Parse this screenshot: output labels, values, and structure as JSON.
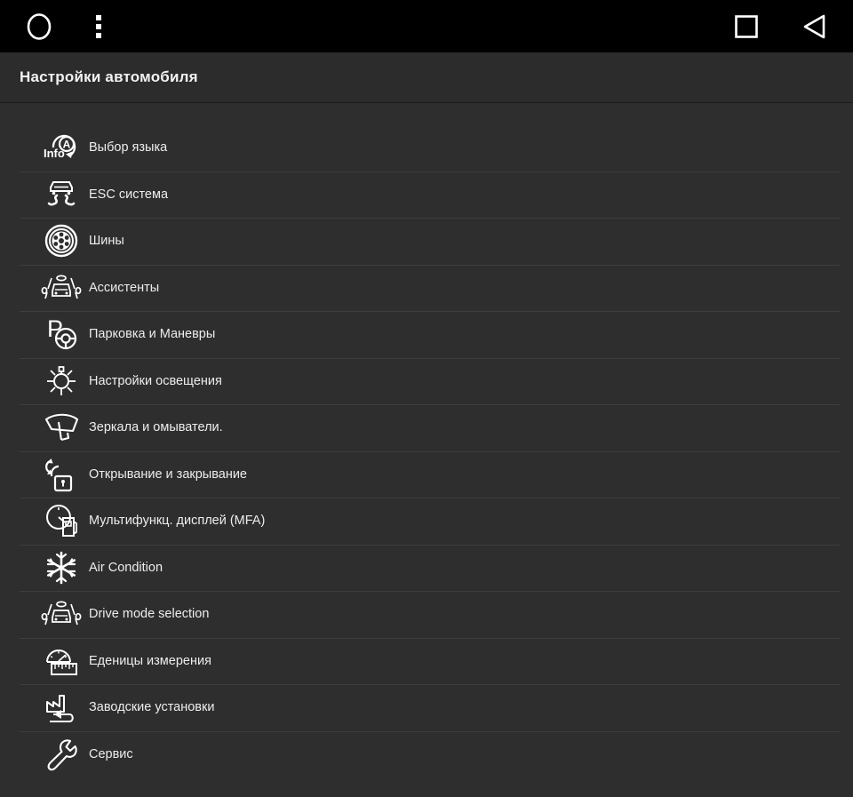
{
  "system_bar": {
    "home_icon": "circle-home-icon",
    "menu_icon": "overflow-menu-icon",
    "recents_icon": "square-recents-icon",
    "back_icon": "triangle-back-icon"
  },
  "header": {
    "title": "Настройки автомобиля"
  },
  "theme": {
    "background": "#2e2e2e",
    "sysbar_background": "#000000",
    "titlebar_background": "#2c2c2c",
    "divider": "#3e3e3e",
    "text": "#ededed"
  },
  "menu": {
    "items": [
      {
        "label": "Выбор языка",
        "icon": "language-info-icon"
      },
      {
        "label": "ESC система",
        "icon": "esc-stability-icon"
      },
      {
        "label": "Шины",
        "icon": "tire-wheel-icon"
      },
      {
        "label": "Ассистенты",
        "icon": "driver-assist-icon"
      },
      {
        "label": "Парковка и Маневры",
        "icon": "parking-maneuver-icon"
      },
      {
        "label": "Настройки освещения",
        "icon": "lighting-sun-icon"
      },
      {
        "label": "Зеркала и омыватели.",
        "icon": "wiper-washer-icon"
      },
      {
        "label": "Открывание и закрывание",
        "icon": "lock-open-close-icon"
      },
      {
        "label": "Мультифункц. дисплей (MFA)",
        "icon": "mfa-display-icon"
      },
      {
        "label": "Air Condition",
        "icon": "snowflake-ac-icon"
      },
      {
        "label": "Drive mode selection",
        "icon": "drive-mode-icon"
      },
      {
        "label": "Еденицы измерения",
        "icon": "units-measure-icon"
      },
      {
        "label": "Заводские установки",
        "icon": "factory-reset-icon"
      },
      {
        "label": "Сервис",
        "icon": "wrench-service-icon"
      }
    ]
  }
}
